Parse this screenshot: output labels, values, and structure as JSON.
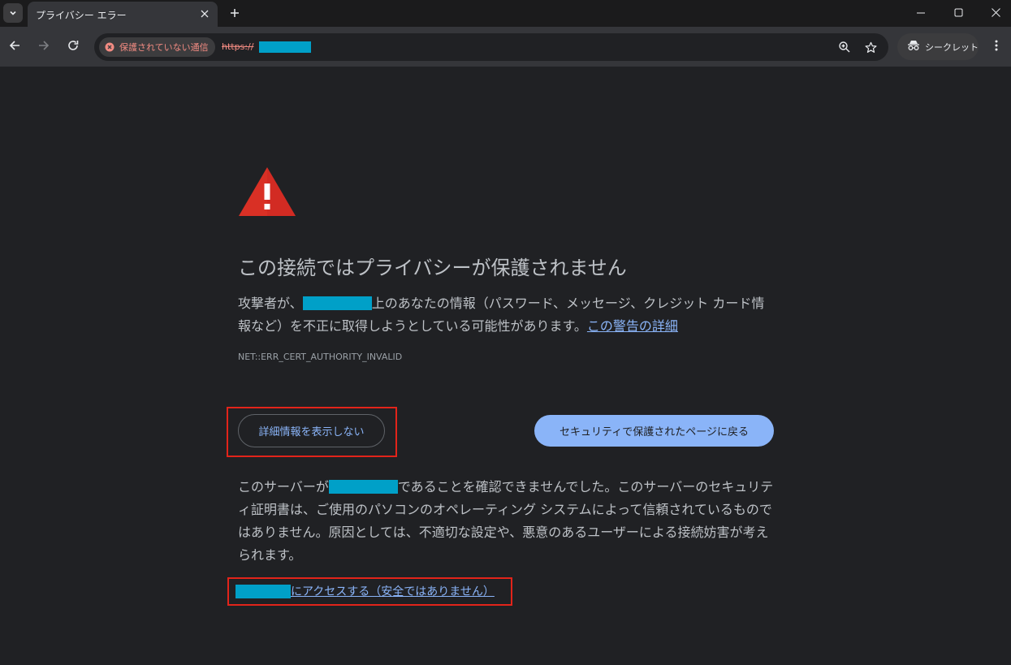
{
  "browser": {
    "tab_title": "プライバシー エラー",
    "chip_label": "保護されていない通信",
    "url_scheme": "https://",
    "incognito_label": "シークレット"
  },
  "colors": {
    "accent": "#8ab4f8",
    "danger": "#f28b82",
    "warning_icon": "#d93025",
    "highlight_box": "#e2241a",
    "redaction": "#00a0c8"
  },
  "icons": [
    "chevron-down-icon",
    "close-icon",
    "plus-icon",
    "minimize-icon",
    "maximize-icon",
    "back-arrow-icon",
    "forward-arrow-icon",
    "reload-icon",
    "error-circle-icon",
    "zoom-icon",
    "star-icon",
    "incognito-icon",
    "more-vert-icon",
    "warning-triangle-icon"
  ],
  "interstitial": {
    "heading": "この接続ではプライバシーが保護されません",
    "intro_before": "攻撃者が、",
    "intro_after": "上のあなたの情報（パスワード、メッセージ、クレジット カード情報など）を不正に取得しようとしている可能性があります。",
    "learn_more_link": "この警告の詳細",
    "error_code": "NET::ERR_CERT_AUTHORITY_INVALID",
    "hide_details_button": "詳細情報を表示しない",
    "back_to_safety_button": "セキュリティで保護されたページに戻る",
    "details_before": "このサーバーが",
    "details_after": "であることを確認できませんでした。このサーバーのセキュリティ証明書は、ご使用のパソコンのオペレーティング システムによって信頼されているものではありません。原因としては、不適切な設定や、悪意のあるユーザーによる接続妨害が考えられます。",
    "proceed_link": "にアクセスする（安全ではありません）"
  }
}
